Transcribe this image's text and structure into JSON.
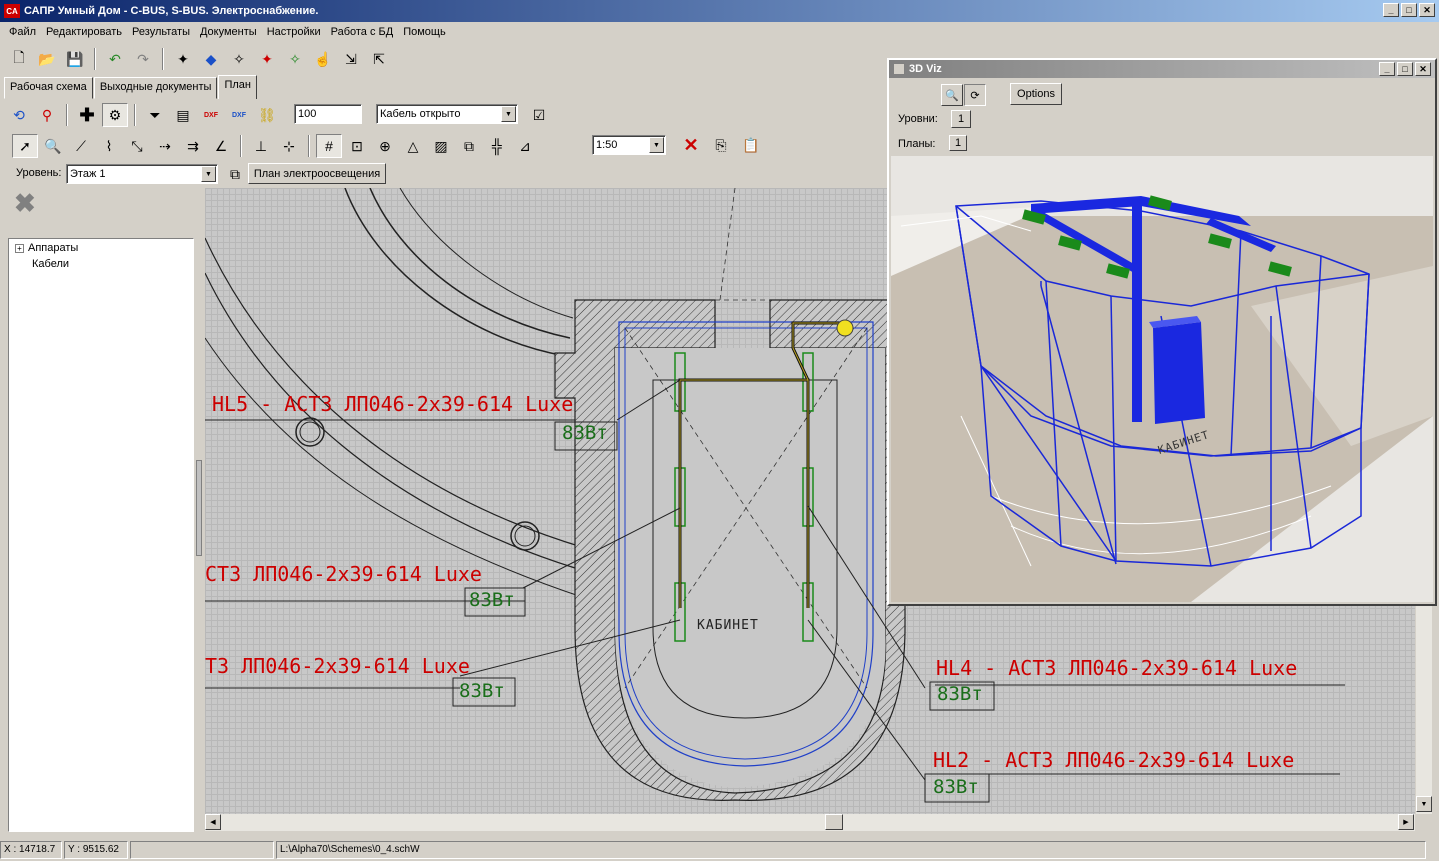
{
  "window": {
    "title": "САПР Умный Дом - C-BUS, S-BUS. Электроснабжение.",
    "logo": "CA"
  },
  "menu": [
    "Файл",
    "Редактировать",
    "Результаты",
    "Документы",
    "Настройки",
    "Работа с БД",
    "Помощь"
  ],
  "tabs": [
    "Рабочая схема",
    "Выходные документы",
    "План"
  ],
  "toolbar2": {
    "scale_input": "100",
    "cable_mode": "Кабель открыто",
    "dxf1": "DXF",
    "dxf2": "DXF"
  },
  "toolbar3": {
    "scale_select": "1:50"
  },
  "level_bar": {
    "label": "Уровень:",
    "level_value": "Этаж 1",
    "plan_button": "План электроосвещения"
  },
  "tree": {
    "items": [
      "Аппараты",
      "Кабели"
    ]
  },
  "drawing": {
    "labels": [
      {
        "name": "HL5 - АСТЗ ЛП046-2x39-614 Luxe",
        "power": "83Вт"
      },
      {
        "name": "СТЗ ЛП046-2x39-614 Luxe",
        "power": "83Вт"
      },
      {
        "name": "ТЗ ЛП046-2x39-614 Luxe",
        "power": "83Вт"
      },
      {
        "name": "HL4 - АСТЗ ЛП046-2x39-614 Luxe",
        "power": "83Вт"
      },
      {
        "name": "HL2 - АСТЗ ЛП046-2x39-614 Luxe",
        "power": "83Вт"
      }
    ],
    "room_label": "КАБИНЕТ",
    "label_color": "#cc0000",
    "power_color": "#1a6e1a"
  },
  "viz": {
    "title": "3D Viz",
    "options_button": "Options",
    "levels_label": "Уровни:",
    "levels_value": "1",
    "plans_label": "Планы:",
    "plans_value": "1",
    "room_label": "КАБИНЕТ"
  },
  "status": {
    "x": "X : 14718.7",
    "y": "Y : 9515.62",
    "path": "L:\\Alpha70\\Schemes\\0_4.schW"
  }
}
